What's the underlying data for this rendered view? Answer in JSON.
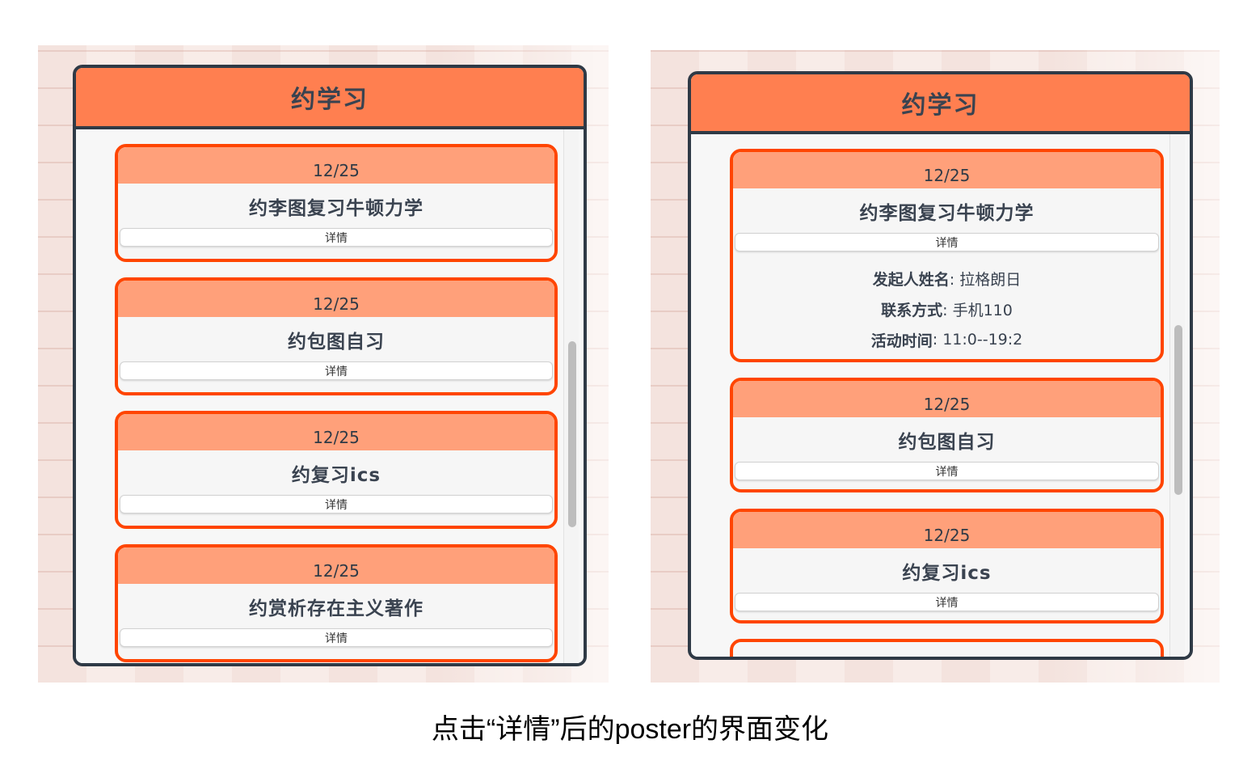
{
  "left_screen": {
    "header_title": "约学习",
    "cards": [
      {
        "date": "12/25",
        "title": "约李图复习牛顿力学",
        "button": "详情"
      },
      {
        "date": "12/25",
        "title": "约包图自习",
        "button": "详情"
      },
      {
        "date": "12/25",
        "title": "约复习ics",
        "button": "详情"
      },
      {
        "date": "12/25",
        "title": "约赏析存在主义著作",
        "button": "详情"
      }
    ]
  },
  "right_screen": {
    "header_title": "约学习",
    "cards": [
      {
        "date": "12/25",
        "title": "约李图复习牛顿力学",
        "button": "详情",
        "details": [
          {
            "label": "发起人姓名",
            "value": ": 拉格朗日"
          },
          {
            "label": "联系方式",
            "value": ": 手机110"
          },
          {
            "label": "活动时间",
            "value": ": 11:0--19:2"
          }
        ]
      },
      {
        "date": "12/25",
        "title": "约包图自习",
        "button": "详情"
      },
      {
        "date": "12/25",
        "title": "约复习ics",
        "button": "详情"
      }
    ]
  },
  "caption": "点击“详情”后的poster的界面变化",
  "colors": {
    "header": "#ff7f50",
    "card_border": "#ff4500",
    "card_date_bg": "#ffa07a",
    "frame": "#2f3a46"
  }
}
